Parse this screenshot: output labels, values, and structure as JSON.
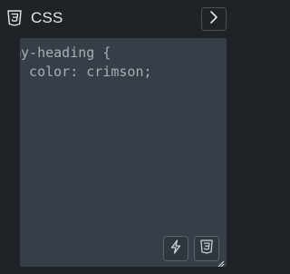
{
  "header": {
    "title": "CSS",
    "language_icon": "css3-icon",
    "expand_icon": "chevron-right-icon"
  },
  "editor": {
    "lines": [
      "my-heading {",
      "  color: crimson;"
    ]
  },
  "toolbar": {
    "format_icon": "lightning-icon",
    "css_icon": "css3-icon"
  },
  "colors": {
    "panel_bg": "#1f2328",
    "editor_bg": "#363f47",
    "code_text": "#a6aeb6",
    "title_text": "#e6e6e6"
  }
}
